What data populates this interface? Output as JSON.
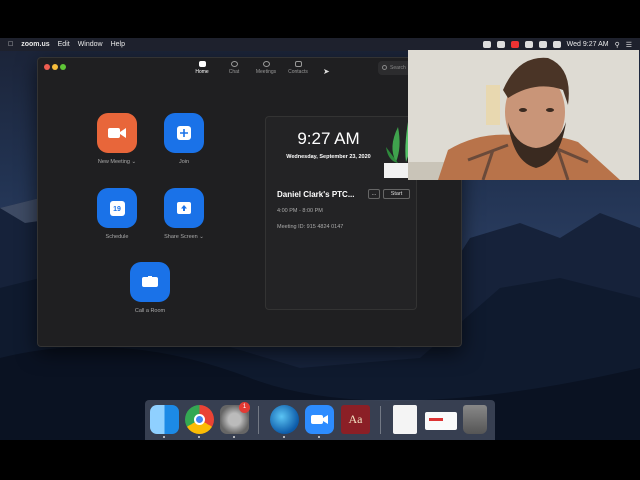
{
  "menubar": {
    "app_name": "zoom.us",
    "menus": [
      "Edit",
      "Window",
      "Help"
    ],
    "clock": "Wed 9:27 AM"
  },
  "zoom": {
    "tabs": [
      {
        "label": "Home",
        "icon": "home-icon",
        "active": true
      },
      {
        "label": "Chat",
        "icon": "chat-icon",
        "active": false
      },
      {
        "label": "Meetings",
        "icon": "clock-icon",
        "active": false
      },
      {
        "label": "Contacts",
        "icon": "contacts-icon",
        "active": false
      }
    ],
    "search_placeholder": "Search",
    "actions": {
      "new_meeting": "New Meeting",
      "join": "Join",
      "schedule": "Schedule",
      "schedule_day": "19",
      "share_screen": "Share Screen",
      "call_room": "Call a Room"
    },
    "colors": {
      "orange": "#e8663a",
      "blue": "#1a72e8"
    }
  },
  "card": {
    "time": "9:27 AM",
    "date": "Wednesday, September 23, 2020",
    "meeting_title": "Daniel Clark's PTC...",
    "more_label": "...",
    "start_label": "Start",
    "meeting_time": "4:00 PM - 8:00 PM",
    "meeting_id": "Meeting ID: 915 4824 0147"
  },
  "dock": {
    "apps": [
      "finder-icon",
      "chrome-icon",
      "system-preferences-icon",
      "edge-icon",
      "zoom-icon",
      "dictionary-icon",
      "document-icon",
      "preview-icon",
      "trash-icon"
    ],
    "badge_count": "1",
    "dictionary_letters": "Aa"
  }
}
